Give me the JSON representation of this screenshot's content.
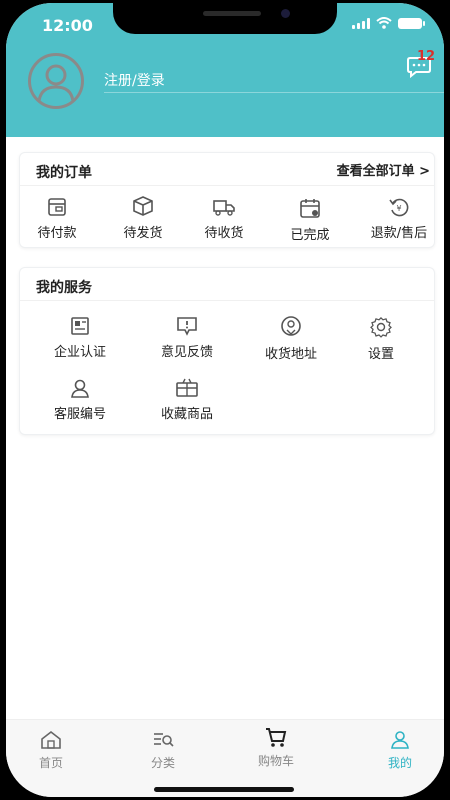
{
  "status": {
    "time": "12:00"
  },
  "header": {
    "login_label": "注册/登录",
    "message_count": "12"
  },
  "orders": {
    "title": "我的订单",
    "view_all": "查看全部订单 >",
    "items": [
      {
        "label": "待付款",
        "icon": "wallet-icon"
      },
      {
        "label": "待发货",
        "icon": "package-icon"
      },
      {
        "label": "待收货",
        "icon": "truck-icon"
      },
      {
        "label": "已完成",
        "icon": "calendar-check-icon"
      },
      {
        "label": "退款/售后",
        "icon": "refund-icon"
      }
    ]
  },
  "services": {
    "title": "我的服务",
    "items": [
      {
        "label": "企业认证",
        "icon": "id-card-icon"
      },
      {
        "label": "意见反馈",
        "icon": "feedback-icon"
      },
      {
        "label": "收货地址",
        "icon": "location-icon"
      },
      {
        "label": "设置",
        "icon": "gear-icon"
      },
      {
        "label": "客服编号",
        "icon": "user-icon"
      },
      {
        "label": "收藏商品",
        "icon": "gift-box-icon"
      }
    ]
  },
  "tabbar": {
    "items": [
      {
        "label": "首页",
        "icon": "home-icon"
      },
      {
        "label": "分类",
        "icon": "category-search-icon"
      },
      {
        "label": "购物车",
        "icon": "cart-icon"
      },
      {
        "label": "我的",
        "icon": "person-icon"
      }
    ],
    "active_index": 3
  },
  "colors": {
    "accent": "#4fc0c8",
    "badge": "#d9302c",
    "active_tab": "#2fb3c4"
  }
}
